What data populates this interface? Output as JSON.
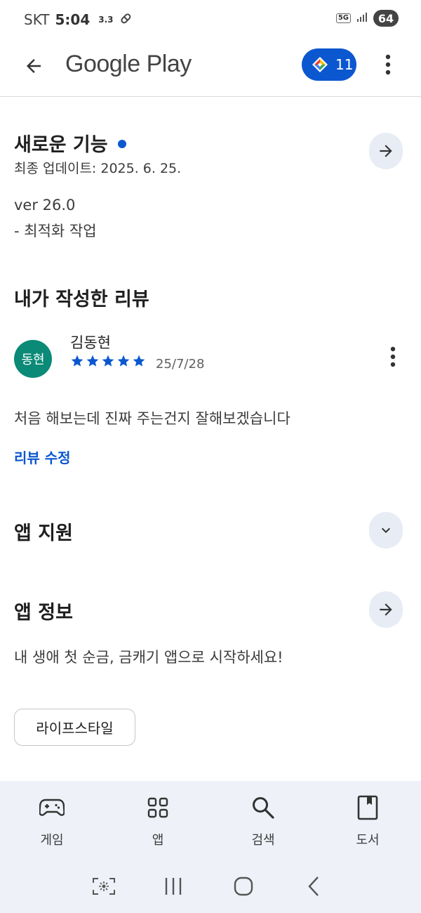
{
  "status_bar": {
    "carrier": "SKT",
    "time": "5:04",
    "speed": "3.3",
    "network": "5G",
    "battery": "64"
  },
  "app_bar": {
    "title": "Google Play",
    "points": "11"
  },
  "whats_new": {
    "title": "새로운 기능",
    "updated": "최종 업데이트: 2025. 6. 25.",
    "version": "ver 26.0",
    "note": "- 최적화 작업"
  },
  "my_review": {
    "title": "내가 작성한 리뷰",
    "avatar_text": "동현",
    "reviewer": "김동현",
    "rating": 5,
    "date": "25/7/28",
    "text": "처음 해보는데 진짜 주는건지 잘해보겠습니다",
    "edit_label": "리뷰 수정"
  },
  "app_support": {
    "title": "앱 지원"
  },
  "app_info": {
    "title": "앱 정보",
    "description": "내 생애 첫 순금, 금캐기 앱으로 시작하세요!",
    "category_chip": "라이프스타일"
  },
  "bottom_nav": {
    "items": [
      {
        "label": "게임",
        "icon": "gamepad-icon"
      },
      {
        "label": "앱",
        "icon": "apps-grid-icon"
      },
      {
        "label": "검색",
        "icon": "search-icon"
      },
      {
        "label": "도서",
        "icon": "book-icon"
      }
    ]
  },
  "colors": {
    "accent": "#0b57d0",
    "avatar": "#0a8a77",
    "nav_bg": "#eef1f7",
    "circle_btn": "#e7ecf5"
  }
}
